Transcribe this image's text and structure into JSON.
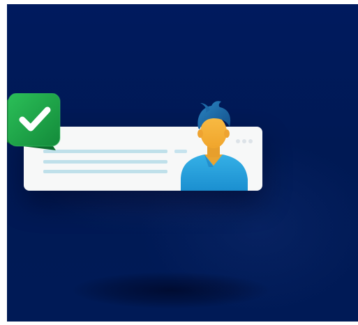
{
  "scene": {
    "background_color": "#001a5e",
    "card_color": "#f7f8f8",
    "text_line_color": "#bfe0ea",
    "badge_color": "#1ea24a",
    "badge_icon": "check-icon",
    "person_shirt_color": "#2aa3dc",
    "person_skin_color": "#f6b23b",
    "person_hair_color": "#1b6aa5"
  }
}
